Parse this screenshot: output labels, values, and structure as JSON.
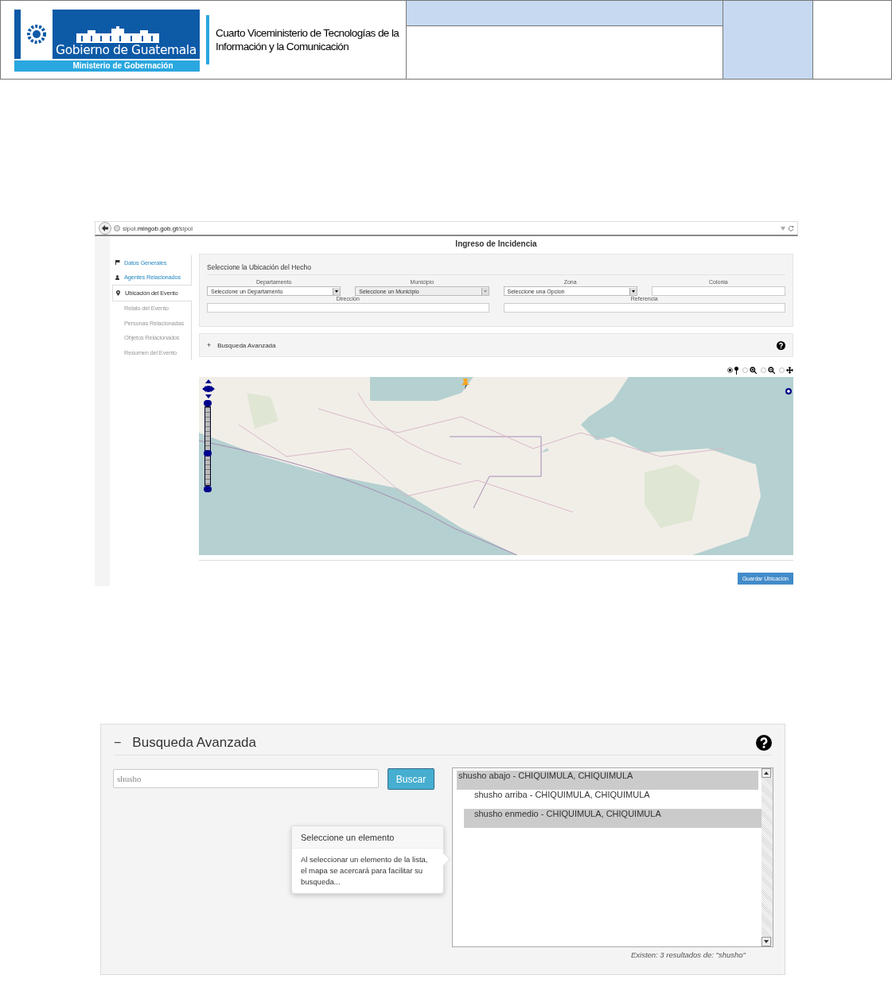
{
  "header": {
    "logo_title": "Gobierno de Guatemala",
    "logo_subtitle": "Ministerio de Gobernación",
    "org_name": "Cuarto Viceministerio de Tecnologías de la Información y la Comunicación"
  },
  "app": {
    "url_host": "sipol.",
    "url_domain": "mingob.gob.gt",
    "url_path": "/sipol",
    "page_title": "Ingreso de Incidencia",
    "nav": [
      {
        "label": "Datos Generales",
        "selected": false,
        "enabled": true
      },
      {
        "label": "Agentes Relacionados",
        "selected": false,
        "enabled": true
      },
      {
        "label": "Ubicación del Evento",
        "selected": true,
        "enabled": true
      },
      {
        "label": "Relato del Evento",
        "selected": false,
        "enabled": false
      },
      {
        "label": "Personas Relacionadas",
        "selected": false,
        "enabled": false
      },
      {
        "label": "Objetos Relacionados",
        "selected": false,
        "enabled": false
      },
      {
        "label": "Resumen del Evento",
        "selected": false,
        "enabled": false
      }
    ],
    "location": {
      "title": "Seleccione la Ubicación del Hecho",
      "fields": [
        {
          "kind": "select",
          "label": "Departamento",
          "value": "Seleccione un Departamento",
          "disabled": false
        },
        {
          "kind": "select",
          "label": "Municipio",
          "value": "Seleccione un Municipio",
          "disabled": true
        },
        {
          "kind": "select",
          "label": "Zona",
          "value": "Seleccione una Opcion",
          "disabled": false
        },
        {
          "kind": "text",
          "label": "Colonia"
        },
        {
          "kind": "text",
          "label": "Dirección"
        },
        {
          "kind": "text",
          "label": "Referencia"
        }
      ]
    },
    "advanced": {
      "toggle": "+",
      "title": "Busqueda Avanzada"
    },
    "zoom_slider": {
      "level": 0.4
    },
    "map_tools": [
      {
        "selected": true
      },
      {
        "selected": false
      },
      {
        "selected": false
      },
      {
        "selected": false
      }
    ],
    "save_button": "Guardar Ubicación"
  },
  "search": {
    "toggle": "−",
    "title": "Busqueda Avanzada",
    "expanded": true,
    "query": "shusho",
    "button": "Buscar",
    "results": [
      {
        "label": "shusho abajo - CHIQUIMULA, CHIQUIMULA",
        "selected": true
      },
      {
        "label": "shusho arriba - CHIQUIMULA, CHIQUIMULA",
        "selected": false
      },
      {
        "label": "shusho enmedio - CHIQUIMULA, CHIQUIMULA",
        "selected": true
      }
    ],
    "popover": {
      "title": "Seleccione un elemento",
      "body": "Al seleccionar un elemento de la lista, el mapa se acercará para facilitar su busqueda..."
    },
    "summary": "Existen: 3 resultados de: \"shusho\""
  }
}
